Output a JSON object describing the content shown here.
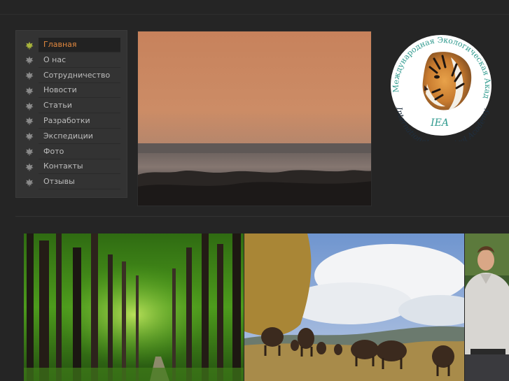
{
  "menu": [
    {
      "label": "Главная",
      "active": true
    },
    {
      "label": "О нас"
    },
    {
      "label": "Сотрудничество"
    },
    {
      "label": "Новости"
    },
    {
      "label": "Статьи"
    },
    {
      "label": "Разработки"
    },
    {
      "label": "Экспедиции"
    },
    {
      "label": "Фото"
    },
    {
      "label": "Контакты"
    },
    {
      "label": "Отзывы"
    }
  ],
  "logo": {
    "arc_top": "Международная Экологическая Академия",
    "arc_bottom": "International Ecological Academy",
    "abbr": "IEA"
  },
  "colors": {
    "accent": "#e3893f",
    "logo_text": "#2f9a8e",
    "leaf_active": "#a8b43c",
    "leaf": "#8a8a8a"
  }
}
